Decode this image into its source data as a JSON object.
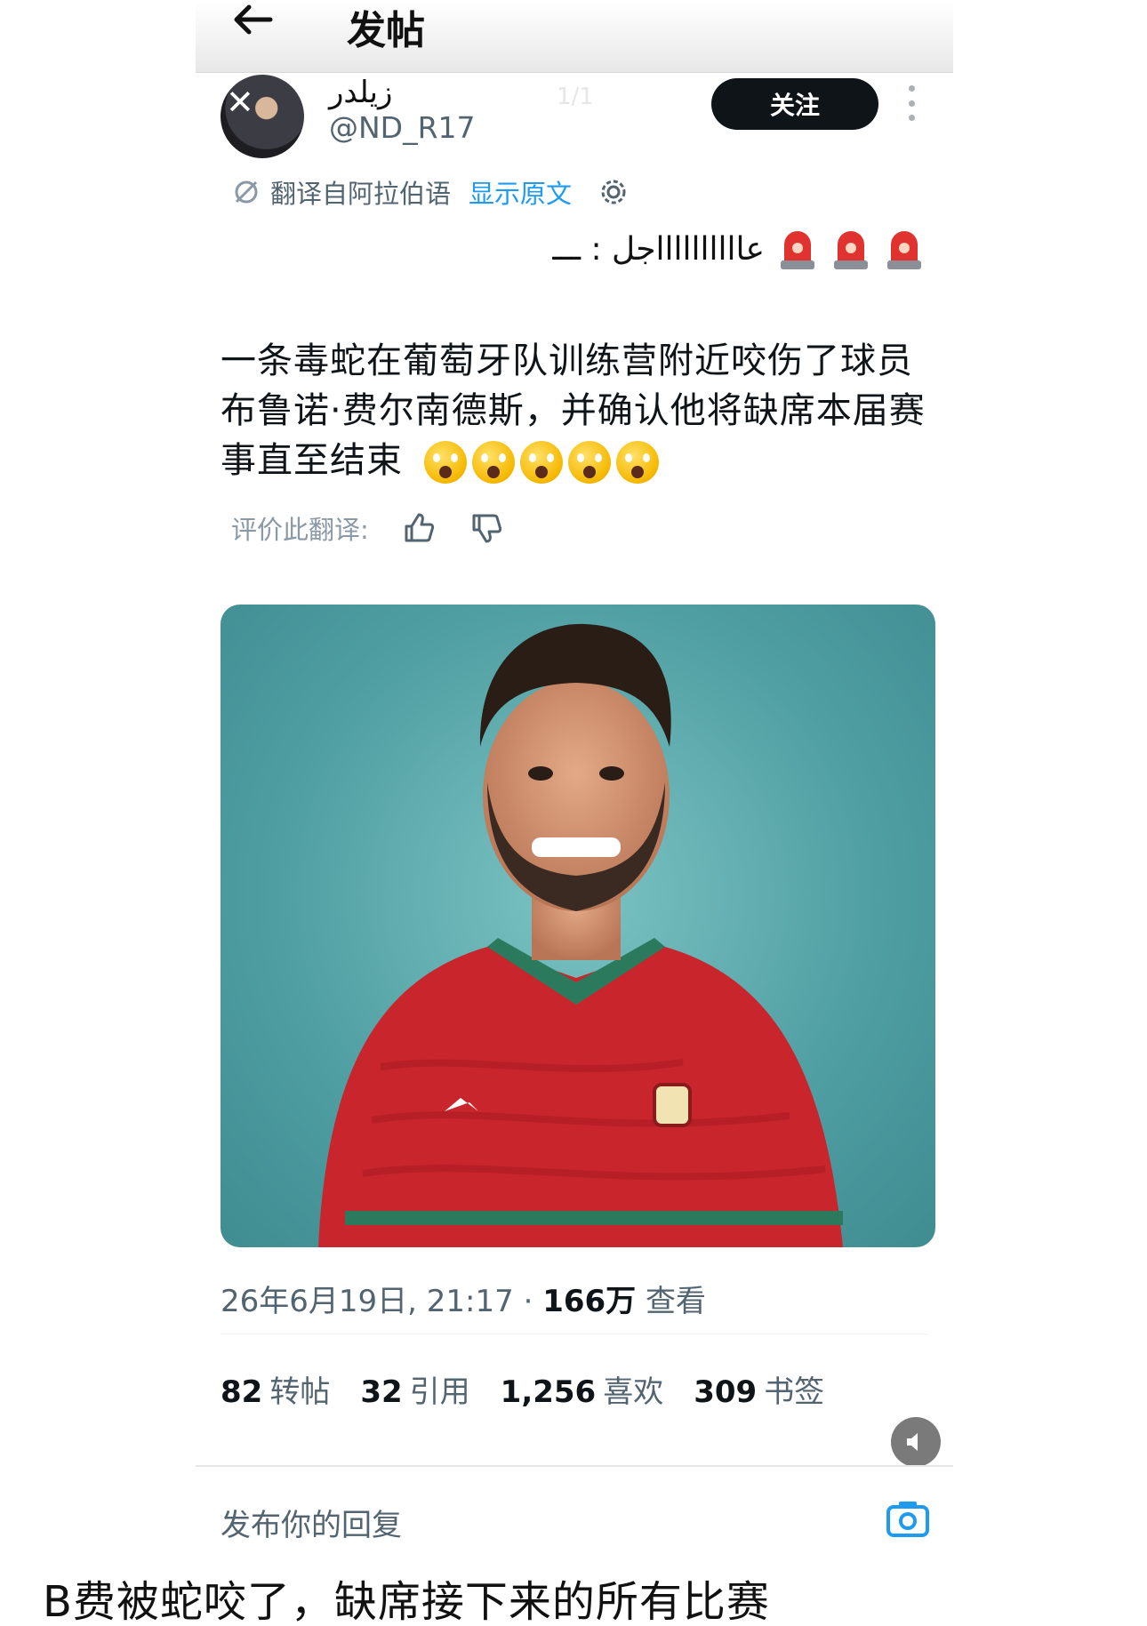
{
  "topbar": {
    "title": "发帖"
  },
  "post": {
    "display_name": "زيلدر",
    "handle": "@ND_R17",
    "page_indicator": "1/1",
    "follow_label": "关注",
    "translate_label": "翻译自阿拉伯语",
    "show_original_label": "显示原文",
    "original_text": "عااااااااااجل : ـــ",
    "translated_text": "一条毒蛇在葡萄牙队训练营附近咬伤了球员布鲁诺·费尔南德斯，并确认他将缺席本届赛事直至结束",
    "rate_translation_label": "评价此翻译:",
    "timestamp": "26年6月19日, 21:17 ·",
    "views_count": "166万",
    "views_label": "查看",
    "stats": [
      {
        "count": "82",
        "label": "转帖"
      },
      {
        "count": "32",
        "label": "引用"
      },
      {
        "count": "1,256",
        "label": "喜欢"
      },
      {
        "count": "309",
        "label": "书签"
      }
    ],
    "reply_placeholder": "发布你的回复"
  },
  "caption": "B费被蛇咬了，缺席接下来的所有比赛",
  "colors": {
    "accent": "#1d9bf0",
    "text_primary": "#0f1419",
    "text_secondary": "#536471",
    "jersey_red": "#c8262c",
    "photo_bg": "#5aa7aa"
  },
  "icons": [
    "back-arrow-icon",
    "more-dots-icon",
    "translate-icon",
    "settings-gear-icon",
    "siren-icon",
    "thumbs-up-icon",
    "thumbs-down-icon",
    "speaker-icon",
    "camera-icon"
  ]
}
